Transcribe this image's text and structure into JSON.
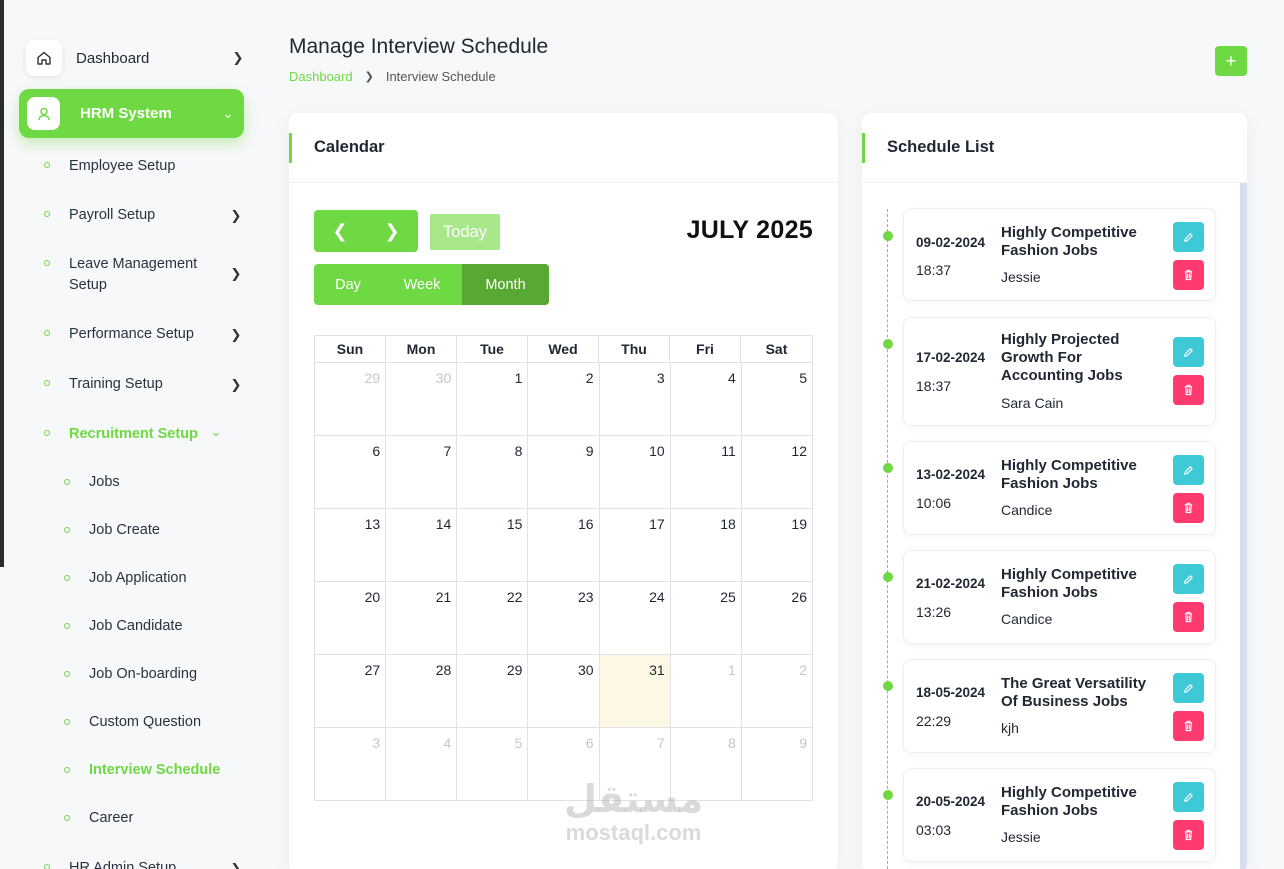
{
  "sidebar": {
    "dashboard": "Dashboard",
    "hrm": "HRM System",
    "employee_setup": "Employee Setup",
    "payroll_setup": "Payroll Setup",
    "leave_setup": "Leave Management Setup",
    "performance_setup": "Performance Setup",
    "training_setup": "Training Setup",
    "recruitment_setup": "Recruitment Setup",
    "recruitment_items": [
      "Jobs",
      "Job Create",
      "Job Application",
      "Job Candidate",
      "Job On-boarding",
      "Custom Question",
      "Interview Schedule",
      "Career"
    ],
    "hr_admin_setup": "HR Admin Setup"
  },
  "header": {
    "title": "Manage Interview Schedule",
    "breadcrumb_link": "Dashboard",
    "breadcrumb_current": "Interview Schedule",
    "add_label": "+"
  },
  "calendar": {
    "title": "Calendar",
    "today": "Today",
    "month_label": "JULY 2025",
    "views": [
      "Day",
      "Week",
      "Month"
    ],
    "active_view": "Month",
    "weekdays": [
      "Sun",
      "Mon",
      "Tue",
      "Wed",
      "Thu",
      "Fri",
      "Sat"
    ],
    "weeks": [
      [
        "29",
        "30",
        "1",
        "2",
        "3",
        "4",
        "5"
      ],
      [
        "6",
        "7",
        "8",
        "9",
        "10",
        "11",
        "12"
      ],
      [
        "13",
        "14",
        "15",
        "16",
        "17",
        "18",
        "19"
      ],
      [
        "20",
        "21",
        "22",
        "23",
        "24",
        "25",
        "26"
      ],
      [
        "27",
        "28",
        "29",
        "30",
        "31",
        "1",
        "2"
      ],
      [
        "3",
        "4",
        "5",
        "6",
        "7",
        "8",
        "9"
      ]
    ],
    "today_date": "31"
  },
  "schedule": {
    "title": "Schedule List",
    "items": [
      {
        "date": "09-02-2024",
        "time": "18:37",
        "job": "Highly Competitive Fashion Jobs",
        "candidate": "Jessie"
      },
      {
        "date": "17-02-2024",
        "time": "18:37",
        "job": "Highly Projected Growth For Accounting Jobs",
        "candidate": "Sara Cain"
      },
      {
        "date": "13-02-2024",
        "time": "10:06",
        "job": "Highly Competitive Fashion Jobs",
        "candidate": "Candice"
      },
      {
        "date": "21-02-2024",
        "time": "13:26",
        "job": "Highly Competitive Fashion Jobs",
        "candidate": "Candice"
      },
      {
        "date": "18-05-2024",
        "time": "22:29",
        "job": "The Great Versatility Of Business Jobs",
        "candidate": "kjh"
      },
      {
        "date": "20-05-2024",
        "time": "03:03",
        "job": "Highly Competitive Fashion Jobs",
        "candidate": "Jessie"
      }
    ]
  },
  "watermark": {
    "arabic": "مستقل",
    "latin": "mostaql.com"
  },
  "colors": {
    "accent": "#6fd943",
    "accent_dark": "#5aa834",
    "edit": "#3ec9d6",
    "delete": "#ff3a6e",
    "today_bg": "#fcf8e3"
  }
}
